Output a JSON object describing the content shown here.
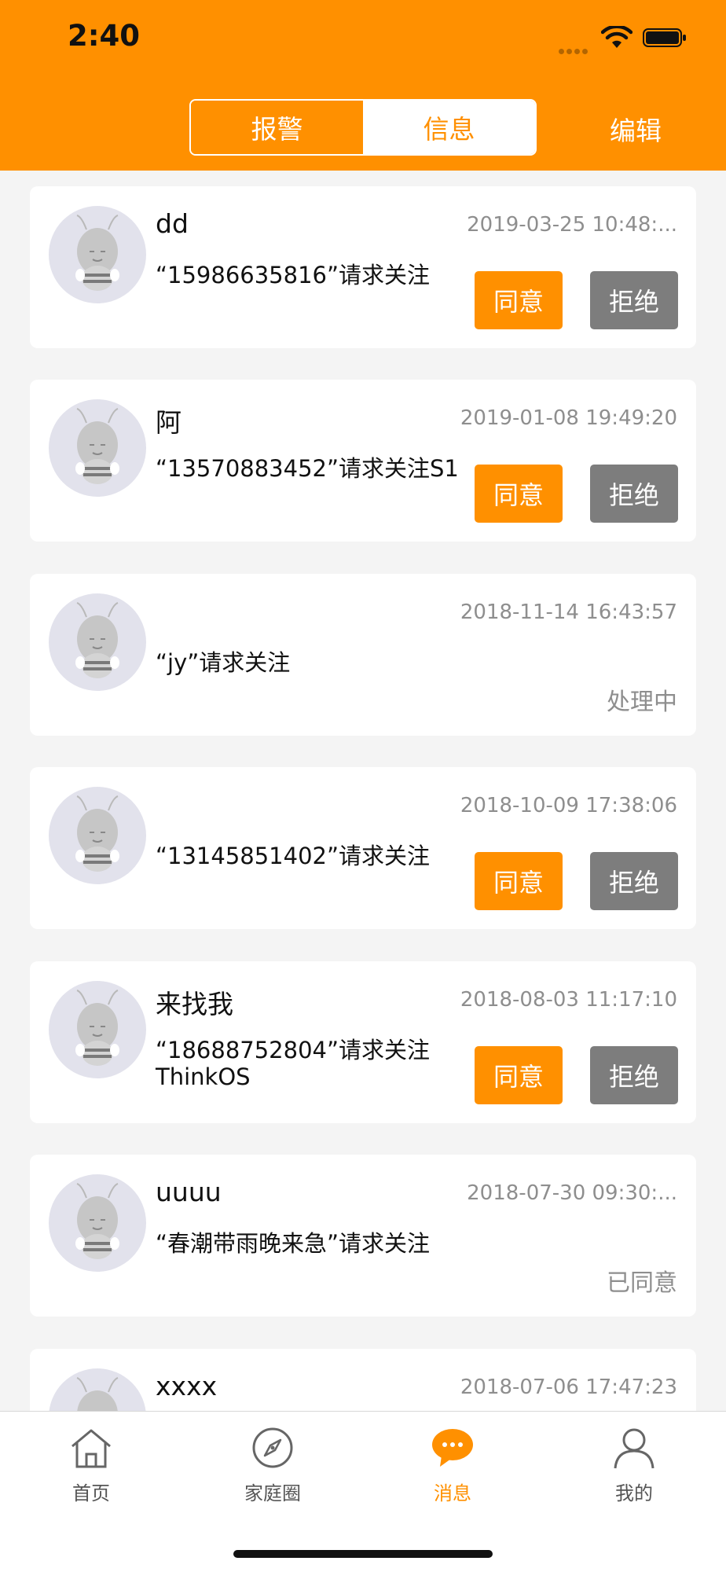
{
  "status_bar": {
    "time": "2:40"
  },
  "header": {
    "segments": [
      {
        "label": "报警",
        "active": true
      },
      {
        "label": "信息",
        "active": false
      }
    ],
    "edit_label": "编辑"
  },
  "colors": {
    "accent": "#ff9000",
    "reject": "#7d7d7d",
    "muted": "#8e8e8e",
    "background": "#f4f4f4"
  },
  "messages": [
    {
      "name": "dd",
      "time": "2019-03-25 10:48:...",
      "text": "“15986635816”请求关注",
      "agree_label": "同意",
      "reject_label": "拒绝"
    },
    {
      "name": "阿",
      "time": "2019-01-08 19:49:20",
      "text": "“13570883452”请求关注S1",
      "agree_label": "同意",
      "reject_label": "拒绝"
    },
    {
      "name": "",
      "time": "2018-11-14 16:43:57",
      "text": "“jy”请求关注",
      "status": "处理中"
    },
    {
      "name": "",
      "time": "2018-10-09 17:38:06",
      "text": "“13145851402”请求关注",
      "agree_label": "同意",
      "reject_label": "拒绝"
    },
    {
      "name": "来找我",
      "time": "2018-08-03 11:17:10",
      "text": "“18688752804”请求关注ThinkOS",
      "agree_label": "同意",
      "reject_label": "拒绝"
    },
    {
      "name": "uuuu",
      "time": "2018-07-30 09:30:...",
      "text": "“春潮带雨晚来急”请求关注",
      "status": "已同意"
    },
    {
      "name": "xxxx",
      "time": "2018-07-06 17:47:23",
      "text": ""
    }
  ],
  "tabbar": {
    "items": [
      {
        "label": "首页",
        "icon": "home-icon",
        "active": false
      },
      {
        "label": "家庭圈",
        "icon": "compass-icon",
        "active": false
      },
      {
        "label": "消息",
        "icon": "chat-bubble-icon",
        "active": true
      },
      {
        "label": "我的",
        "icon": "person-icon",
        "active": false
      }
    ]
  }
}
